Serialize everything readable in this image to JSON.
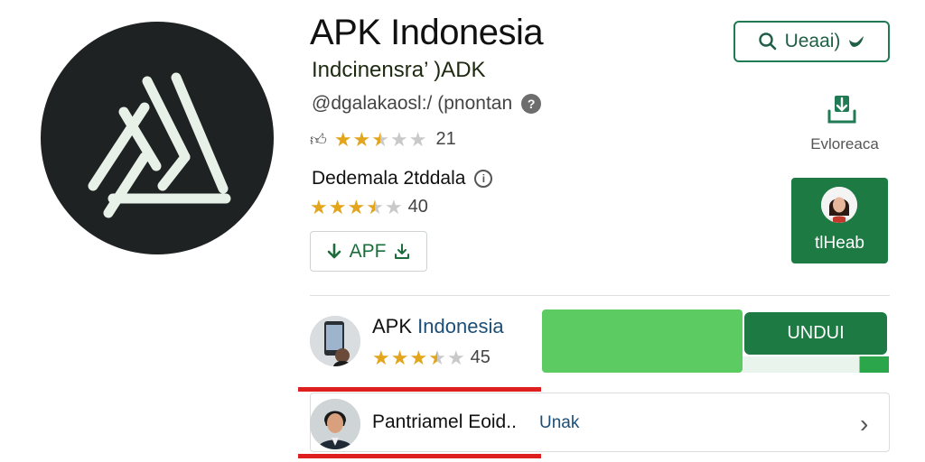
{
  "app": {
    "title": "APK Indonesia",
    "subtitle": "Indcinensra’ )ADK",
    "developer": "@dgalakaosl:/ (pnontan",
    "rating_value": "21",
    "rating_stars": 2.5
  },
  "details": {
    "section_title": "Dedemala 2tddala",
    "rating_value": "40",
    "rating_stars": 3.5,
    "apk_button_label": "APF"
  },
  "header": {
    "search_button_label": "Ueaai)"
  },
  "sidebar": {
    "download_caption": "Evloreaca",
    "user_card_label": "tlHeab"
  },
  "list": {
    "row1": {
      "title_part1": "APK",
      "title_part2": "Indonesia",
      "rating_value": "45",
      "rating_stars": 3.5,
      "action_label": "UNDUI"
    },
    "row2": {
      "title": "Pantriamel Eoid..",
      "link": "Unak"
    }
  },
  "colors": {
    "brand_green": "#1d7a43",
    "light_green": "#5ccb62",
    "star": "#e2a51c",
    "underline_red": "#dd1f1f"
  }
}
